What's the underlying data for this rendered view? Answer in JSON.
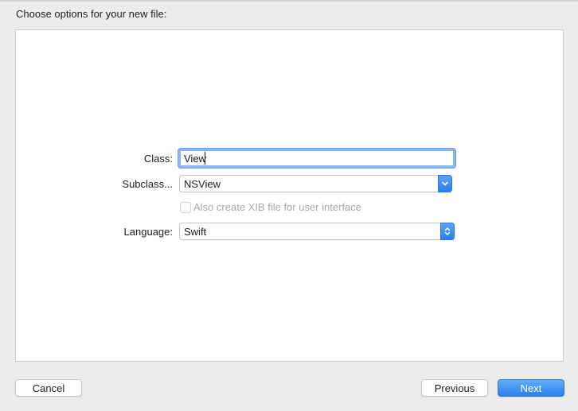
{
  "header": {
    "title": "Choose options for your new file:"
  },
  "form": {
    "class_label": "Class:",
    "class_value": "View",
    "subclass_label": "Subclass...",
    "subclass_value": "NSView",
    "xib_checkbox_label": "Also create XIB file for user interface",
    "xib_checked": false,
    "xib_enabled": false,
    "language_label": "Language:",
    "language_value": "Swift"
  },
  "footer": {
    "cancel_label": "Cancel",
    "previous_label": "Previous",
    "next_label": "Next"
  },
  "icons": {
    "subclass_arrow": "chevron-down-icon",
    "language_arrow": "up-down-chevron-icon"
  },
  "colors": {
    "accent": "#2a7fef",
    "focus_ring": "#8cb6f0"
  }
}
